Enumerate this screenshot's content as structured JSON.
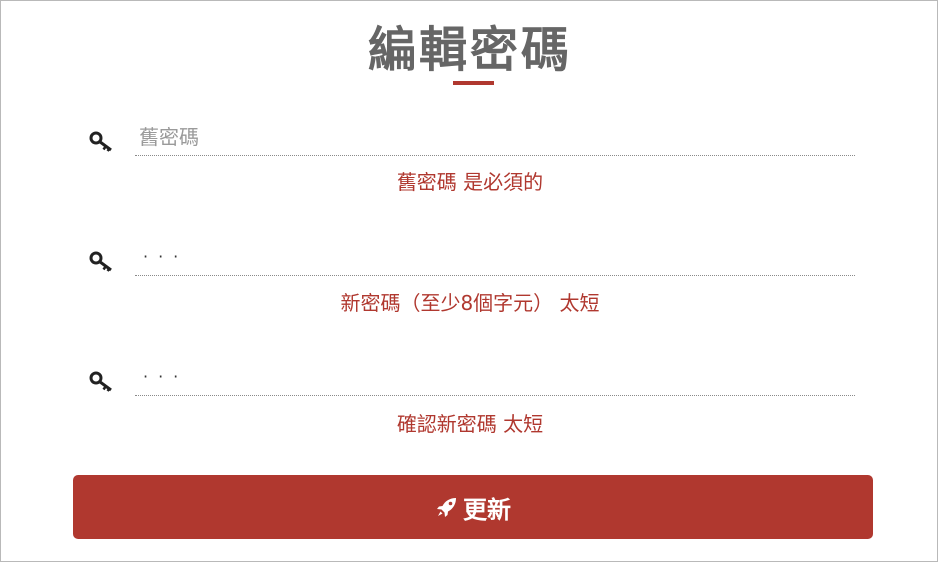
{
  "page": {
    "title": "編輯密碼"
  },
  "form": {
    "old_password": {
      "placeholder": "舊密碼",
      "value": "",
      "error": "舊密碼 是必須的",
      "icon": "key-icon"
    },
    "new_password": {
      "masked_value": "···",
      "error": "新密碼（至少8個字元） 太短",
      "icon": "key-icon"
    },
    "confirm_password": {
      "masked_value": "···",
      "error": "確認新密碼 太短",
      "icon": "key-icon"
    },
    "submit": {
      "label": "更新",
      "icon": "rocket-icon"
    }
  },
  "colors": {
    "accent": "#b0382f",
    "title": "#666666",
    "placeholder": "#9a9a9a"
  }
}
